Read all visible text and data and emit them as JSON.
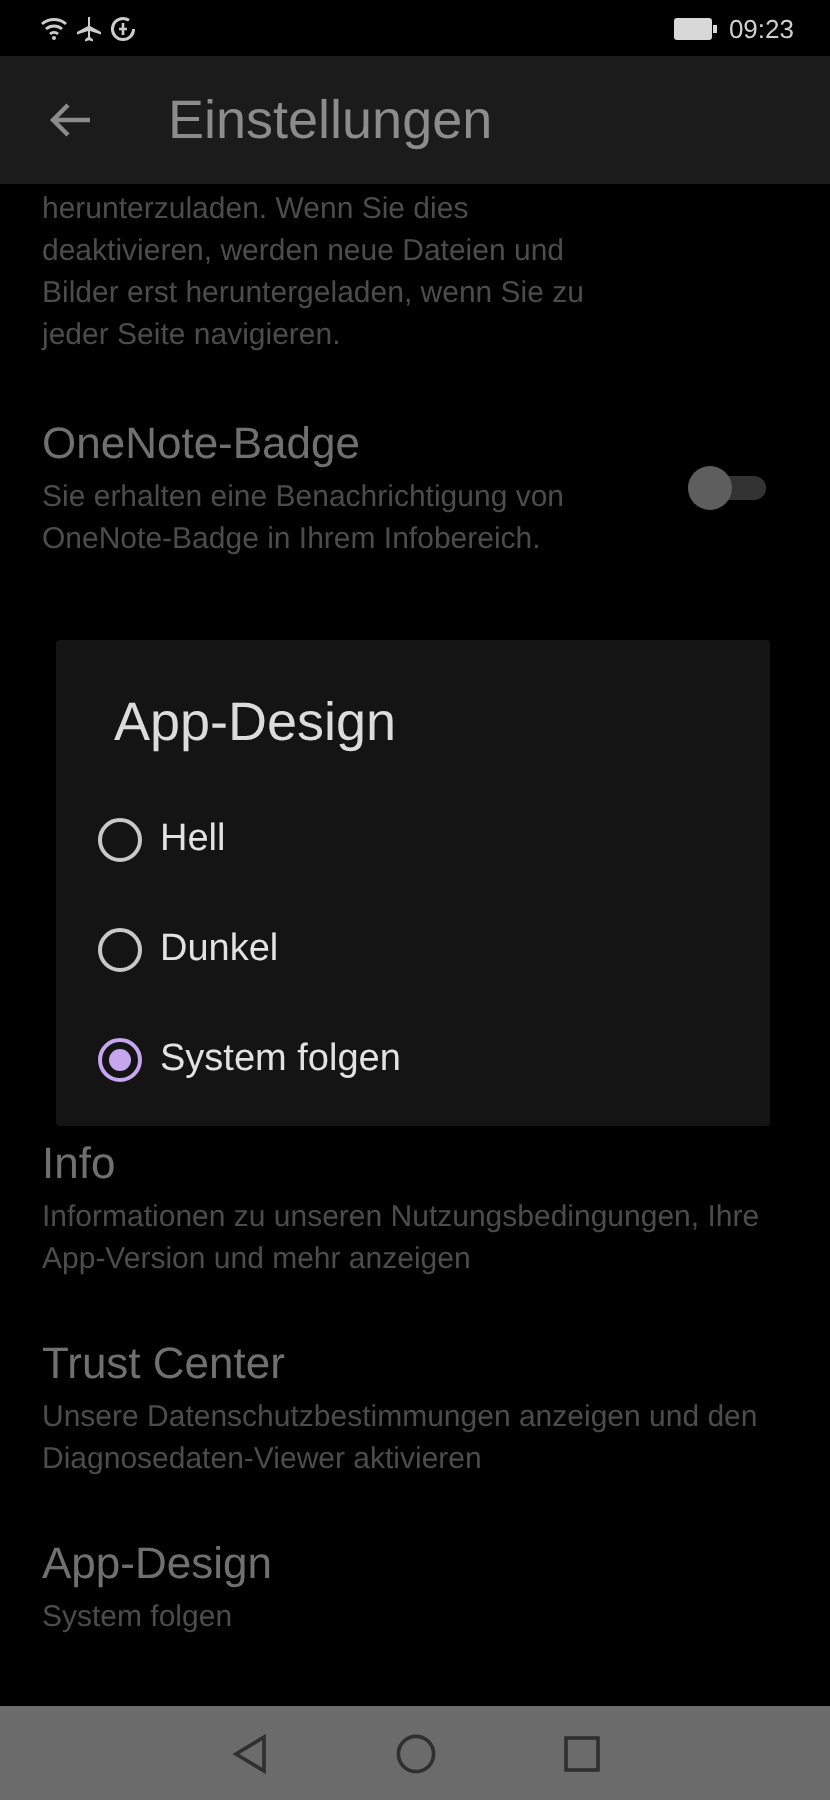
{
  "status_bar": {
    "time": "09:23"
  },
  "app_bar": {
    "title": "Einstellungen"
  },
  "settings_above": [
    {
      "kind": "text",
      "description": "herunterzuladen. Wenn Sie dies deaktivieren, werden neue Dateien und Bilder erst heruntergeladen, wenn Sie zu jeder Seite navigieren."
    },
    {
      "kind": "switch",
      "title": "OneNote-Badge",
      "description": "Sie erhalten eine Benachrichtigung von OneNote-Badge in Ihrem Infobereich.",
      "on": false
    }
  ],
  "settings_below": [
    {
      "title": "Info",
      "description": "Informationen zu unseren Nutzungsbedingungen, Ihre App-Version und mehr anzeigen"
    },
    {
      "title": "Trust Center",
      "description": "Unsere Datenschutzbestimmungen anzeigen und den Diagnosedaten-Viewer aktivieren"
    },
    {
      "title": "App-Design",
      "description": "System folgen"
    }
  ],
  "dialog": {
    "title": "App-Design",
    "options": [
      {
        "label": "Hell",
        "selected": false
      },
      {
        "label": "Dunkel",
        "selected": false
      },
      {
        "label": "System folgen",
        "selected": true
      }
    ]
  }
}
